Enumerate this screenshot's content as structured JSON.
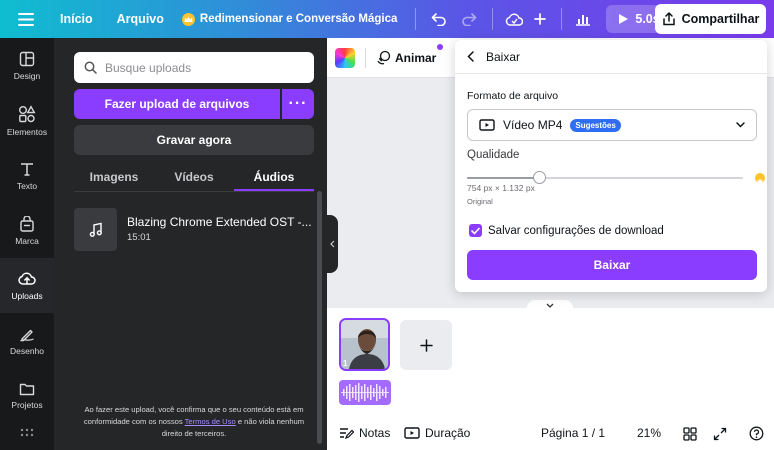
{
  "topbar": {
    "home_label": "Início",
    "file_label": "Arquivo",
    "resize_label": "Redimensionar e Conversão Mágica",
    "play_duration": "5.0s",
    "share_label": "Compartilhar"
  },
  "leftnav": {
    "items": [
      {
        "label": "Design",
        "icon": "layout-icon"
      },
      {
        "label": "Elementos",
        "icon": "shapes-icon"
      },
      {
        "label": "Texto",
        "icon": "text-icon"
      },
      {
        "label": "Marca",
        "icon": "brand-icon"
      },
      {
        "label": "Uploads",
        "icon": "upload-cloud-icon",
        "active": true
      },
      {
        "label": "Desenho",
        "icon": "draw-icon"
      },
      {
        "label": "Projetos",
        "icon": "folder-icon"
      }
    ]
  },
  "uploads": {
    "search_placeholder": "Busque uploads",
    "upload_button": "Fazer upload de arquivos",
    "more_button": "···",
    "record_button": "Gravar agora",
    "tabs": [
      {
        "label": "Imagens"
      },
      {
        "label": "Vídeos"
      },
      {
        "label": "Áudios",
        "active": true
      }
    ],
    "audio_items": [
      {
        "title": "Blazing Chrome Extended OST -...",
        "duration": "15:01"
      }
    ],
    "disclaimer_before": "Ao fazer este upload, você confirma que o seu conteúdo está em conformidade com os nossos ",
    "disclaimer_link": "Termos de Uso",
    "disclaimer_after": " e não viola nenhum direito de terceiros."
  },
  "editor": {
    "animate_label": "Animar",
    "page_number": "1",
    "bottom": {
      "notes_label": "Notas",
      "duration_label": "Duração",
      "page_indicator": "Página 1 / 1",
      "zoom": "21%"
    }
  },
  "download": {
    "header": "Baixar",
    "format_label": "Formato de arquivo",
    "format_value": "Vídeo MP4",
    "format_badge": "Sugestões",
    "quality_label": "Qualidade",
    "quality_fraction": 0.26,
    "dimensions": "754 px × 1.132 px",
    "quality_caption": "Original",
    "save_settings_label": "Salvar configurações de download",
    "save_settings_checked": true,
    "download_button": "Baixar"
  },
  "colors": {
    "accent": "#8b3dff",
    "panel_bg": "#252627",
    "nav_bg": "#18191b",
    "badge_blue": "#2f6ef3"
  }
}
